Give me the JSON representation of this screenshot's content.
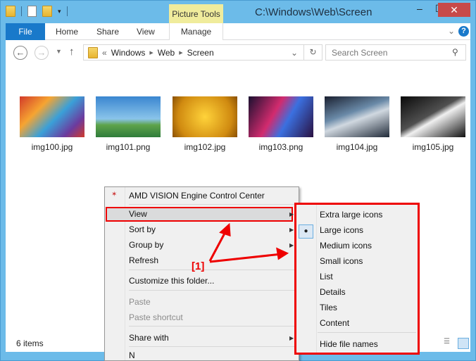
{
  "window": {
    "title": "C:\\Windows\\Web\\Screen",
    "contextual_tab_group": "Picture Tools"
  },
  "ribbon": {
    "tabs": [
      "File",
      "Home",
      "Share",
      "View",
      "Manage"
    ],
    "help": "?"
  },
  "nav": {
    "back": "←",
    "forward": "→",
    "up": "↑",
    "breadcrumb": [
      "Windows",
      "Web",
      "Screen"
    ],
    "overflow": "«",
    "search_placeholder": "Search Screen"
  },
  "files": [
    {
      "name": "img100.jpg",
      "color": "linear-gradient(135deg,#d23a2a,#f6a431 30%,#3aa0d8 55%,#6c3b9e 80%,#d23a2a)"
    },
    {
      "name": "img101.png",
      "color": "linear-gradient(#3a86d0,#8ac4ea 55%,#5ea34a 70%,#2f7c3b)"
    },
    {
      "name": "img102.jpg",
      "color": "radial-gradient(circle,#ffd33a,#d08a10 70%,#8a5004)"
    },
    {
      "name": "img103.png",
      "color": "linear-gradient(120deg,#1a1030,#d22b6e 40%,#3b70e0 60%,#2a1040)"
    },
    {
      "name": "img104.jpg",
      "color": "linear-gradient(160deg,#1a2030,#6a8aa8 40%,#d0d8e0 55%,#202a38)"
    },
    {
      "name": "img105.jpg",
      "color": "linear-gradient(150deg,#0a0a0a,#505050 45%,#f0f0f0 55%,#101010)"
    }
  ],
  "status": {
    "item_count": "6 items"
  },
  "context_menu": {
    "items": [
      {
        "label": "AMD VISION Engine Control Center"
      },
      {
        "label": "View",
        "submenu": true
      },
      {
        "label": "Sort by",
        "submenu": true
      },
      {
        "label": "Group by",
        "submenu": true
      },
      {
        "label": "Refresh"
      },
      {
        "label": "Customize this folder..."
      },
      {
        "label": "Paste",
        "disabled": true
      },
      {
        "label": "Paste shortcut",
        "disabled": true
      },
      {
        "label": "Share with",
        "submenu": true
      },
      {
        "label": "N"
      }
    ]
  },
  "view_submenu": {
    "items": [
      "Extra large icons",
      "Large icons",
      "Medium icons",
      "Small icons",
      "List",
      "Details",
      "Tiles",
      "Content",
      "Hide file names"
    ],
    "selected": "Large icons"
  },
  "annotation": "[1]",
  "colors": {
    "accent": "#1979ca",
    "highlight": "#ee0000",
    "frame": "#6cbbe9"
  }
}
